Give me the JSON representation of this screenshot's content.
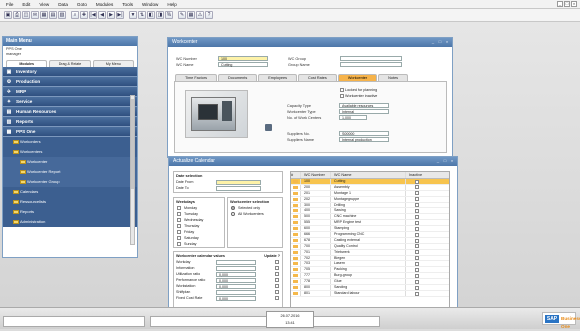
{
  "menubar": [
    "File",
    "Edit",
    "View",
    "Data",
    "Goto",
    "Modules",
    "Tools",
    "Window",
    "Help"
  ],
  "window_controls": [
    "_",
    "□",
    "×"
  ],
  "toolbar_icons": [
    "save-icon",
    "print-icon",
    "preview-icon",
    "email-icon",
    "excel-icon",
    "word-icon",
    "pdf-icon",
    "find-icon",
    "add-icon",
    "first-icon",
    "prev-icon",
    "next-icon",
    "last-icon",
    "filter-icon",
    "sort-icon",
    "base-doc-icon",
    "target-doc-icon",
    "gross-profit-icon",
    "layout-icon",
    "calendar-icon",
    "alert-icon",
    "help-icon"
  ],
  "toolbar_glyphs": [
    "▣",
    "⎙",
    "◫",
    "✉",
    "▦",
    "▤",
    "▧",
    "⌕",
    "✚",
    "|◀",
    "◀",
    "▶",
    "▶|",
    "▼",
    "⇅",
    "◧",
    "◨",
    "%",
    "✎",
    "▦",
    "⚠",
    "?"
  ],
  "main_menu": {
    "title": "Main Menu",
    "company": "PPS One",
    "user": "manager",
    "tabs": [
      "Modules",
      "Drag & Relate",
      "My Menu"
    ],
    "sections": [
      {
        "label": "Inventory",
        "icon": "▣"
      },
      {
        "label": "Production",
        "icon": "⚙"
      },
      {
        "label": "MRP",
        "icon": "✈"
      },
      {
        "label": "Service",
        "icon": "✦"
      },
      {
        "label": "Human Resources",
        "icon": "▤"
      },
      {
        "label": "Reports",
        "icon": "▥"
      },
      {
        "label": "PPS One",
        "icon": "▦"
      }
    ],
    "items": [
      {
        "label": "Workorders",
        "level": 1
      },
      {
        "label": "Workcenters",
        "level": 1
      },
      {
        "label": "Workcenter",
        "level": 2
      },
      {
        "label": "Workcenter Report",
        "level": 2
      },
      {
        "label": "Workcenter Group",
        "level": 2
      },
      {
        "label": "Calendars",
        "level": 1
      },
      {
        "label": "Ressourcelists",
        "level": 1
      },
      {
        "label": "Reports",
        "level": 1
      },
      {
        "label": "Administration",
        "level": 1
      }
    ]
  },
  "workcenter": {
    "title": "Workcenter",
    "wc_number_label": "WC Number",
    "wc_number": "100",
    "wc_name_label": "WC Name",
    "wc_name": "Cutting",
    "wc_group_label": "WC Group",
    "wc_group": "",
    "group_name_label": "Group Name",
    "group_name": "",
    "tabs": [
      "Time Factors",
      "Documents",
      "Employees",
      "Cost Rates",
      "Workcenter",
      "Notes"
    ],
    "active_tab": "Workcenter",
    "locked_label": "Locked for planning",
    "inactive_label": "Workcenter inactive",
    "capacity_type_label": "Capacity Type",
    "capacity_type": "Available resources",
    "wc_type_label": "Workcenter Type",
    "wc_type": "Internal",
    "num_wc_label": "No. of Work Centers",
    "num_wc": "1,000",
    "supplier_no_label": "Suppliers No.",
    "supplier_no": "S00000",
    "supplier_name_label": "Suppliers Name",
    "supplier_name": "Internal production"
  },
  "calendar": {
    "title": "Actualize Calendar",
    "date_selection_title": "Date selection",
    "date_from_label": "Date From",
    "date_to_label": "Date To",
    "date_from": "",
    "date_to": "",
    "weekdays_title": "Weekdays",
    "weekdays": [
      "Monday",
      "Tuesday",
      "Wednesday",
      "Thursday",
      "Friday",
      "Saturday",
      "Sunday"
    ],
    "wc_selection_title": "Workcenter selection",
    "wc_selection_options": [
      "Selected only",
      "All Workcenters"
    ],
    "values_title": "Workcenter calendar values",
    "update_label": "Update ?",
    "value_rows": [
      {
        "label": "Workday",
        "value": ""
      },
      {
        "label": "Information",
        "value": ""
      },
      {
        "label": "Utilization ratio",
        "value": "0,000"
      },
      {
        "label": "Performance ratio",
        "value": "0,000"
      },
      {
        "label": "Workstation",
        "value": "0,000"
      },
      {
        "label": "Shiftplan",
        "value": ""
      },
      {
        "label": "Fixed Cost Rate",
        "value": "0,000"
      }
    ],
    "grid_headers": [
      "#",
      "WC Number",
      "WC Name",
      "Inactive"
    ],
    "grid_rows": [
      [
        "100",
        "Cutting"
      ],
      [
        "200",
        "Assembly"
      ],
      [
        "201",
        "Montage 1"
      ],
      [
        "202",
        "Montagegruppe"
      ],
      [
        "300",
        "Drilling"
      ],
      [
        "400",
        "Sawing"
      ],
      [
        "500",
        "CNC machine"
      ],
      [
        "555",
        "MRP Engine test"
      ],
      [
        "600",
        "Stamping"
      ],
      [
        "666",
        "Programming CNC"
      ],
      [
        "678",
        "Casting external"
      ],
      [
        "700",
        "Quality Control"
      ],
      [
        "701",
        "Triebwerk"
      ],
      [
        "702",
        "Biegen"
      ],
      [
        "703",
        "Lasern"
      ],
      [
        "705",
        "Packing"
      ],
      [
        "777",
        "Burg-group"
      ],
      [
        "778",
        "Glue"
      ],
      [
        "800",
        "Sanding"
      ],
      [
        "801",
        "Standard labour"
      ]
    ]
  },
  "status": {
    "date": "26.07.2016",
    "time": "13:41",
    "brand": "SAP",
    "brand_suffix": "Business One"
  }
}
